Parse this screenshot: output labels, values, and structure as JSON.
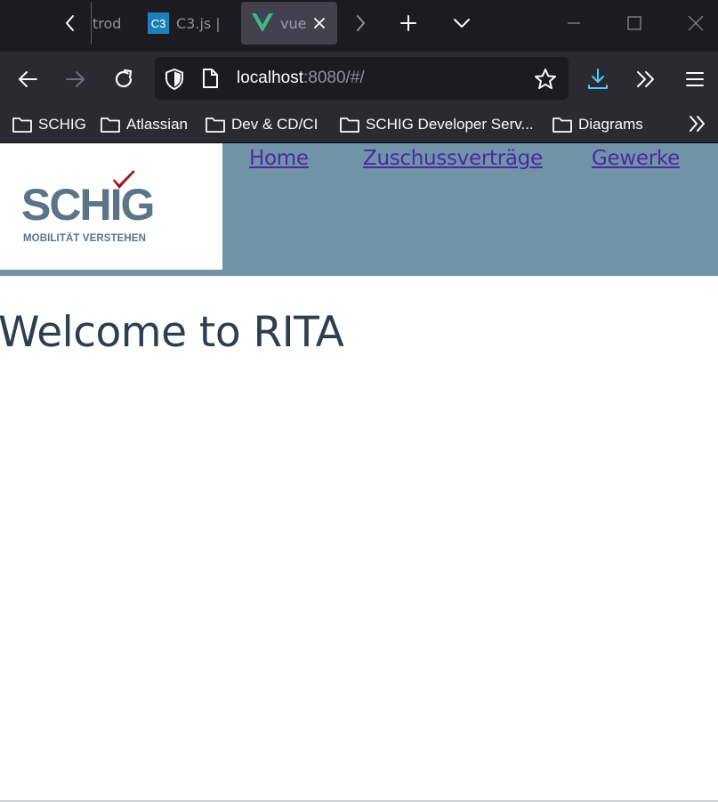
{
  "browser": {
    "tabs": [
      {
        "label": "trod"
      },
      {
        "label": "C3.js |",
        "favicon_text": "C3"
      },
      {
        "label": "vue",
        "active": true
      }
    ],
    "url": {
      "host": "localhost",
      "rest": ":8080/#/"
    },
    "bookmarks": [
      {
        "label": "SCHIG"
      },
      {
        "label": "Atlassian"
      },
      {
        "label": "Dev & CD/CI"
      },
      {
        "label": "SCHIG Developer Serv..."
      },
      {
        "label": "Diagrams"
      }
    ]
  },
  "page": {
    "logo": {
      "brand": "SCHIG",
      "tagline": "MOBILITÄT VERSTEHEN"
    },
    "nav": [
      {
        "label": "Home"
      },
      {
        "label": "Zuschussverträge"
      },
      {
        "label": "Gewerke"
      }
    ],
    "heading": "Welcome to RITA"
  },
  "colors": {
    "header_bg": "#7193a8",
    "link": "#4b2aa3",
    "heading": "#2c3e50",
    "logo_text": "#5a7589",
    "logo_check": "#a0171d",
    "vue_green": "#41b883"
  }
}
